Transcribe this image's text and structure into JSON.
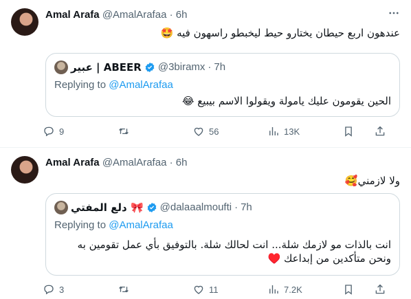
{
  "tweets": [
    {
      "name": "Amal Arafa",
      "handle": "@AmalArafaa",
      "dot": "·",
      "time": "6h",
      "text": "عندهون اربع حيطان يختارو حيط ليخبطو راسهون فيه 🤩",
      "quote": {
        "name": "عبير | ABEER",
        "handle": "@3biramx",
        "dot": "·",
        "time": "7h",
        "replying_prefix": "Replying to ",
        "replying_mention": "@AmalArafaa",
        "text": "الحين يقومون عليك يامولة ويقولوا الاسم بيبيع 😂"
      },
      "actions": {
        "replies": "9",
        "retweets": "",
        "likes": "56",
        "views": "13K"
      }
    },
    {
      "name": "Amal Arafa",
      "handle": "@AmalArafaa",
      "dot": "·",
      "time": "6h",
      "text": "ولا لازمني🥰",
      "quote": {
        "name": "دلع المفتي 🎀",
        "handle": "@dalaaalmoufti",
        "dot": "·",
        "time": "7h",
        "replying_prefix": "Replying to ",
        "replying_mention": "@AmalArafaa",
        "text": "انت بالذات مو لازمك شلة... انت لحالك شلة. بالتوفيق بأي عمل تقومين به ونحن متأكدين من إبداعك ♥️"
      },
      "actions": {
        "replies": "3",
        "retweets": "",
        "likes": "11",
        "views": "7.2K"
      }
    }
  ],
  "colors": {
    "accent": "#1d9bf0",
    "muted": "#536471",
    "border": "#cfd9de",
    "text": "#0f1419"
  },
  "icons": [
    "more-icon",
    "verified-badge-icon",
    "reply-icon",
    "retweet-icon",
    "like-icon",
    "views-icon",
    "bookmark-icon",
    "share-icon"
  ]
}
